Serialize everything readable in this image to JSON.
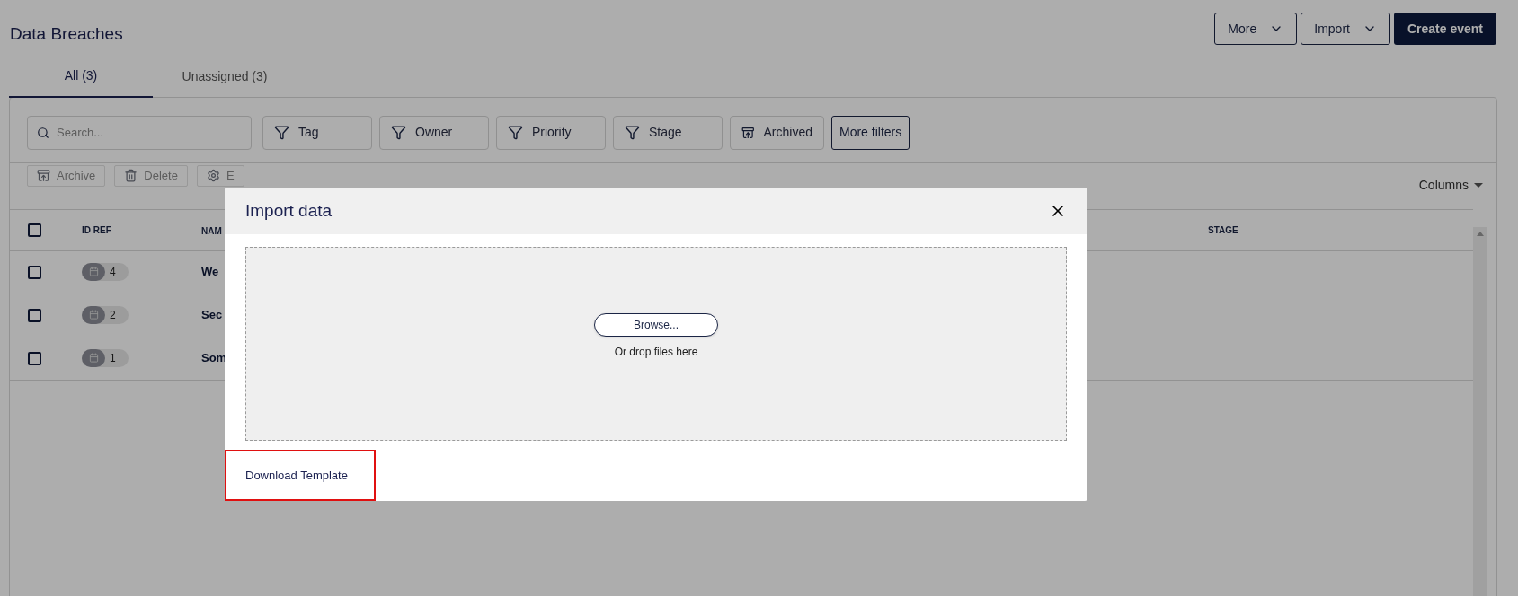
{
  "page": {
    "title": "Data Breaches"
  },
  "header_buttons": [
    {
      "label": "More",
      "kind": "dropdown"
    },
    {
      "label": "Import",
      "kind": "dropdown"
    },
    {
      "label": "Create event",
      "kind": "primary"
    }
  ],
  "tabs": [
    {
      "label": "All (3)",
      "selected": true
    },
    {
      "label": "Unassigned (3)",
      "selected": false
    }
  ],
  "search": {
    "placeholder": "Search..."
  },
  "filters": [
    {
      "label": "Tag",
      "kind": "filter"
    },
    {
      "label": "Owner",
      "kind": "filter"
    },
    {
      "label": "Priority",
      "kind": "filter"
    },
    {
      "label": "Stage",
      "kind": "filter"
    },
    {
      "label": "Archived",
      "kind": "archive"
    },
    {
      "label": "More filters",
      "kind": "outlined"
    }
  ],
  "actions": [
    {
      "label": "Archive",
      "kind": "archive"
    },
    {
      "label": "Delete",
      "kind": "delete"
    },
    {
      "label": "E",
      "kind": "settings"
    }
  ],
  "columns_button": "Columns",
  "table": {
    "select_all_checked": false,
    "columns": [
      "ID REF",
      "NAM",
      "STAGE"
    ],
    "rows": [
      {
        "checked": false,
        "id": "4",
        "name": "We"
      },
      {
        "checked": false,
        "id": "2",
        "name": "Sec"
      },
      {
        "checked": false,
        "id": "1",
        "name": "Som"
      }
    ]
  },
  "modal": {
    "title": "Import data",
    "browse": "Browse...",
    "drop_hint": "Or drop files here",
    "download": {
      "label": "Download Template",
      "highlighted": true
    }
  }
}
